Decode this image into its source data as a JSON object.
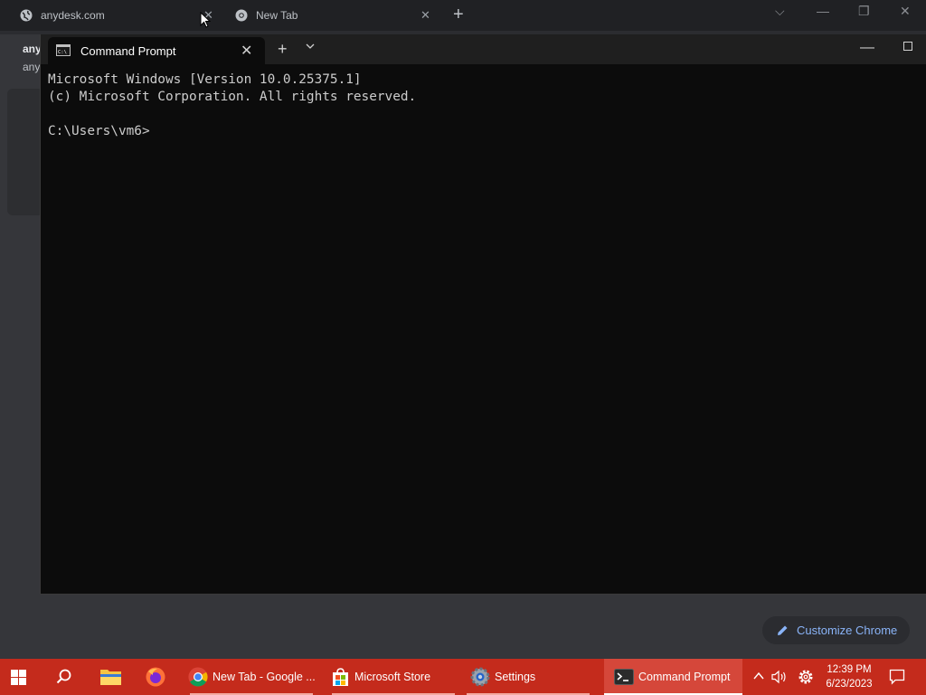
{
  "chrome": {
    "tabs": [
      {
        "label": "anydesk.com",
        "favicon": "globe-icon"
      },
      {
        "label": "New Tab",
        "favicon": "chrome-icon"
      }
    ],
    "page_peek": [
      "any",
      "any"
    ],
    "customize_label": "Customize Chrome",
    "accent_color": "#8ab4f8"
  },
  "terminal": {
    "tab_title": "Command Prompt",
    "lines": [
      "Microsoft Windows [Version 10.0.25375.1]",
      "(c) Microsoft Corporation. All rights reserved.",
      "",
      "C:\\Users\\vm6>"
    ]
  },
  "taskbar": {
    "accent_color": "#c42b1c",
    "apps": [
      {
        "label": "New Tab - Google ...",
        "icon": "chrome-icon"
      },
      {
        "label": "Microsoft Store",
        "icon": "store-icon"
      },
      {
        "label": "Settings",
        "icon": "settings-icon"
      },
      {
        "label": "Command Prompt",
        "icon": "terminal-icon",
        "active": true
      }
    ],
    "clock": {
      "time": "12:39 PM",
      "date": "6/23/2023"
    }
  }
}
